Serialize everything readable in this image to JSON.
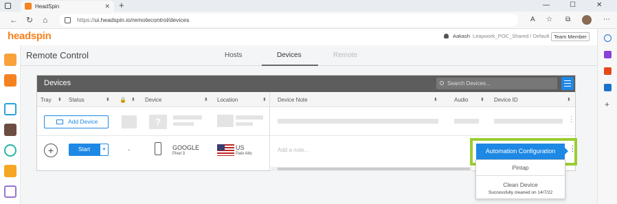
{
  "browser": {
    "tab_title": "HeadSpin",
    "url_prefix": "https://",
    "url": "ui.headspin.io/remotecontrol/devices"
  },
  "app": {
    "logo": "headspin",
    "user_name": "Aakash",
    "workspace": "Leapwork_POC_Shared / Default",
    "role_button": "Team Member",
    "page_title": "Remote Control",
    "tabs": [
      {
        "label": "Hosts",
        "state": "normal"
      },
      {
        "label": "Devices",
        "state": "active"
      },
      {
        "label": "Remote",
        "state": "disabled"
      }
    ]
  },
  "panel": {
    "title": "Devices",
    "search_placeholder": "Search Devices...",
    "columns": [
      "Tray",
      "Status",
      "Device",
      "Location",
      "Device Note",
      "Audio",
      "Device ID"
    ],
    "add_device_label": "Add Device",
    "device_row": {
      "start_label": "Start",
      "lock_value": "-",
      "device_name": "GOOGLE",
      "device_model": "Pixel 3",
      "country": "US",
      "city": "Palo Alto",
      "note_placeholder": "Add a note..."
    }
  },
  "menu": {
    "automation_config": "Automation Configuration",
    "pintap": "Pintap",
    "clean_device": "Clean Device",
    "clean_status": "Successfully cleaned on 14/7/22"
  },
  "colors": {
    "brand": "#f58220",
    "accent": "#1e88e5",
    "highlight": "#9acd32",
    "panel_header": "#5d5d5d"
  }
}
